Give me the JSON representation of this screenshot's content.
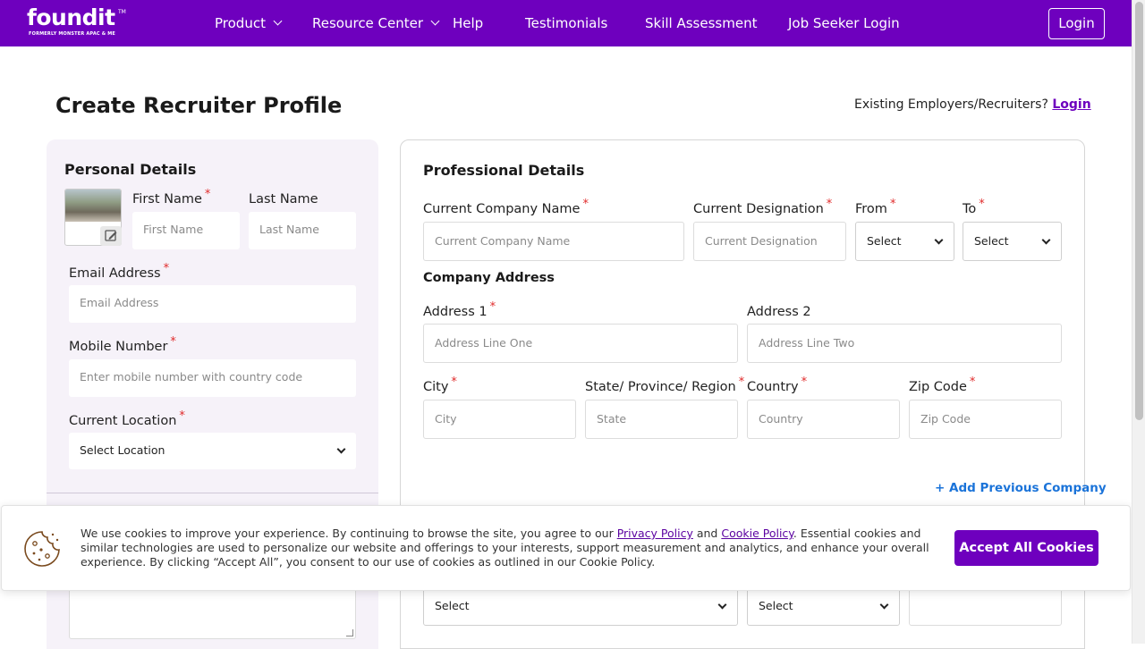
{
  "brand": {
    "logo_text": "foundit",
    "tm": "TM",
    "tagline": "FORMERLY MONSTER APAC & ME",
    "accent": "#6e00be"
  },
  "nav": {
    "items": [
      {
        "label": "Product",
        "dropdown": true
      },
      {
        "label": "Resource Center",
        "dropdown": true
      },
      {
        "label": "Help",
        "dropdown": false
      },
      {
        "label": "Testimonials",
        "dropdown": false
      },
      {
        "label": "Skill Assessment",
        "dropdown": false
      },
      {
        "label": "Job Seeker Login",
        "dropdown": false
      }
    ],
    "login": "Login"
  },
  "page": {
    "title": "Create Recruiter Profile",
    "existing_text": "Existing Employers/Recruiters?",
    "existing_link": "Login"
  },
  "personal": {
    "title": "Personal Details",
    "first_name_label": "First Name",
    "first_name_placeholder": "First Name",
    "last_name_label": "Last Name",
    "last_name_placeholder": "Last Name",
    "email_label": "Email Address",
    "email_placeholder": "Email Address",
    "mobile_label": "Mobile Number",
    "mobile_placeholder": "Enter mobile number with country code",
    "location_label": "Current Location",
    "location_value": "Select Location",
    "required_mark": "*"
  },
  "professional": {
    "title": "Professional Details",
    "company_label": "Current Company Name",
    "company_placeholder": "Current Company Name",
    "designation_label": "Current Designation",
    "designation_placeholder": "Current Designation",
    "from_label": "From",
    "from_value": "Select",
    "to_label": "To",
    "to_value": "Select",
    "address_title": "Company Address",
    "address1_label": "Address 1",
    "address1_placeholder": "Address Line One",
    "address2_label": "Address 2",
    "address2_placeholder": "Address Line Two",
    "city_label": "City",
    "city_placeholder": "City",
    "state_label": "State/ Province/ Region",
    "state_placeholder": "State",
    "country_label": "Country",
    "country_placeholder": "Country",
    "zip_label": "Zip Code",
    "zip_placeholder": "Zip Code",
    "add_previous": "+ Add Previous Company",
    "lower_select_1": "Select",
    "lower_select_2": "Select"
  },
  "cookie": {
    "text_1": "We use cookies to improve your experience. By continuing to browse the site, you agree to our ",
    "privacy_link": "Privacy Policy",
    "text_2": " and ",
    "cookie_link": "Cookie Policy",
    "text_3": ". Essential cookies and similar technologies are used to personalize our website and offerings to your interests, support measurement and analytics, and enhance your overall experience. By clicking “Accept All”, you consent to our use of cookies as outlined in our Cookie Policy.",
    "accept_label": "Accept All Cookies"
  }
}
